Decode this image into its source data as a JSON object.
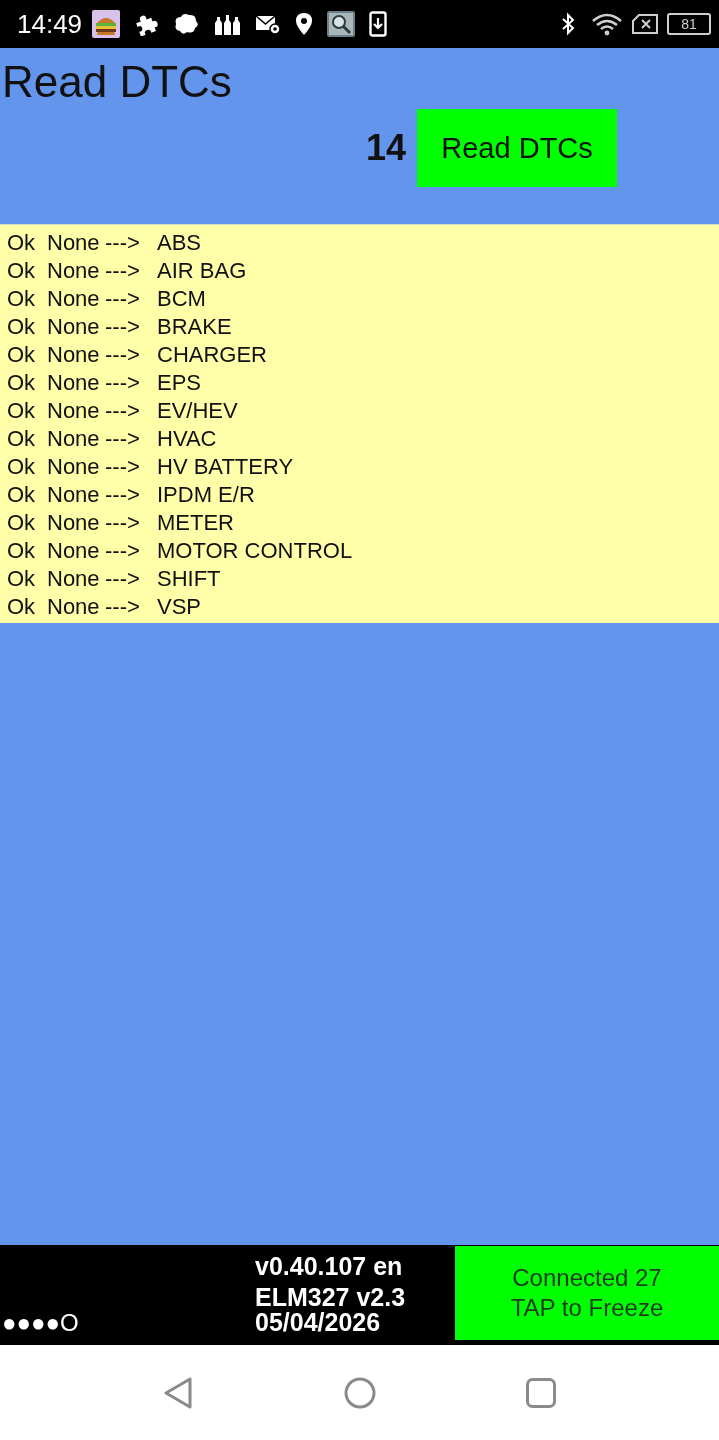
{
  "status_bar": {
    "time": "14:49",
    "battery": "81"
  },
  "header": {
    "title": "Read DTCs",
    "count": "14",
    "button": "Read DTCs"
  },
  "results": [
    {
      "status": "Ok",
      "result": "None",
      "arrow": "--->",
      "module": "ABS"
    },
    {
      "status": "Ok",
      "result": "None",
      "arrow": "--->",
      "module": "AIR BAG"
    },
    {
      "status": "Ok",
      "result": "None",
      "arrow": "--->",
      "module": "BCM"
    },
    {
      "status": "Ok",
      "result": "None",
      "arrow": "--->",
      "module": "BRAKE"
    },
    {
      "status": "Ok",
      "result": "None",
      "arrow": "--->",
      "module": "CHARGER"
    },
    {
      "status": "Ok",
      "result": "None",
      "arrow": "--->",
      "module": "EPS"
    },
    {
      "status": "Ok",
      "result": "None",
      "arrow": "--->",
      "module": "EV/HEV"
    },
    {
      "status": "Ok",
      "result": "None",
      "arrow": "--->",
      "module": "HVAC"
    },
    {
      "status": "Ok",
      "result": "None",
      "arrow": "--->",
      "module": "HV BATTERY"
    },
    {
      "status": "Ok",
      "result": "None",
      "arrow": "--->",
      "module": "IPDM E/R"
    },
    {
      "status": "Ok",
      "result": "None",
      "arrow": "--->",
      "module": "METER"
    },
    {
      "status": "Ok",
      "result": "None",
      "arrow": "--->",
      "module": "MOTOR CONTROL"
    },
    {
      "status": "Ok",
      "result": "None",
      "arrow": "--->",
      "module": "SHIFT"
    },
    {
      "status": "Ok",
      "result": "None",
      "arrow": "--->",
      "module": "VSP"
    }
  ],
  "footer": {
    "indicator": "●●●●O",
    "version": "v0.40.107 en",
    "adapter": "ELM327 v2.3",
    "date": "05/04/2026",
    "connection_button": {
      "lines": [
        "Connected 27",
        "TAP to Freeze"
      ]
    }
  }
}
